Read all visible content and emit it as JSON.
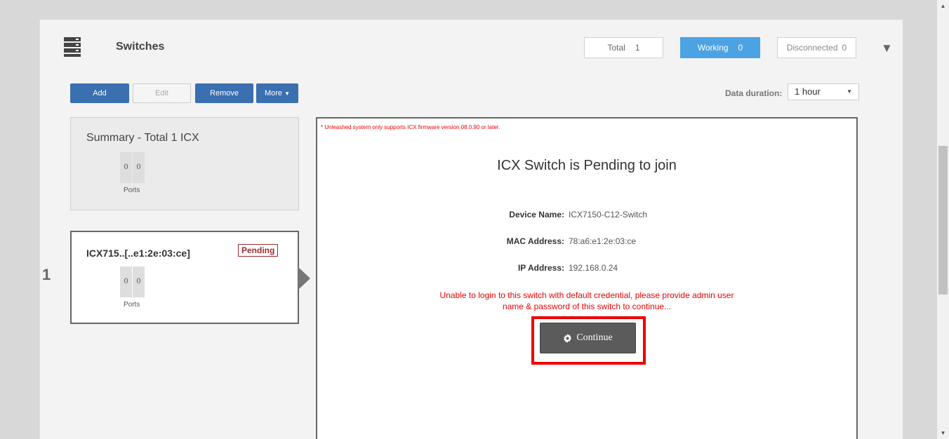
{
  "header": {
    "title": "Switches",
    "stats": {
      "total_label": "Total",
      "total_value": "1",
      "working_label": "Working",
      "working_value": "0",
      "disconnected_label": "Disconnected",
      "disconnected_value": "0"
    }
  },
  "toolbar": {
    "add_label": "Add",
    "edit_label": "Edit",
    "remove_label": "Remove",
    "more_label": "More",
    "duration_label": "Data duration:",
    "duration_value": "1 hour"
  },
  "summary": {
    "title": "Summary - Total 1 ICX",
    "ports": [
      "0",
      "0"
    ],
    "ports_label": "Ports"
  },
  "devices": [
    {
      "row_number": "1",
      "name": "ICX715..[..e1:2e:03:ce]",
      "status": "Pending",
      "ports": [
        "0",
        "0"
      ],
      "ports_label": "Ports"
    }
  ],
  "detail": {
    "firmware_note": "* Unleashed system only supports ICX firmware version 08.0.90 or later.",
    "title": "ICX Switch is Pending to join",
    "fields": [
      {
        "key": "Device Name:",
        "value": "ICX7150-C12-Switch"
      },
      {
        "key": "MAC Address:",
        "value": "78:a6:e1:2e:03:ce"
      },
      {
        "key": "IP Address:",
        "value": "192.168.0.24"
      }
    ],
    "error_line1": "Unable to login to this switch with default credential, please provide admin user",
    "error_line2": "name & password of this switch to continue...",
    "continue_label": "Continue"
  },
  "colors": {
    "accent_blue": "#3a6fb0",
    "working_blue": "#4ba3e3",
    "error_red": "#ee0000",
    "pending_red": "#9b2a2a"
  }
}
